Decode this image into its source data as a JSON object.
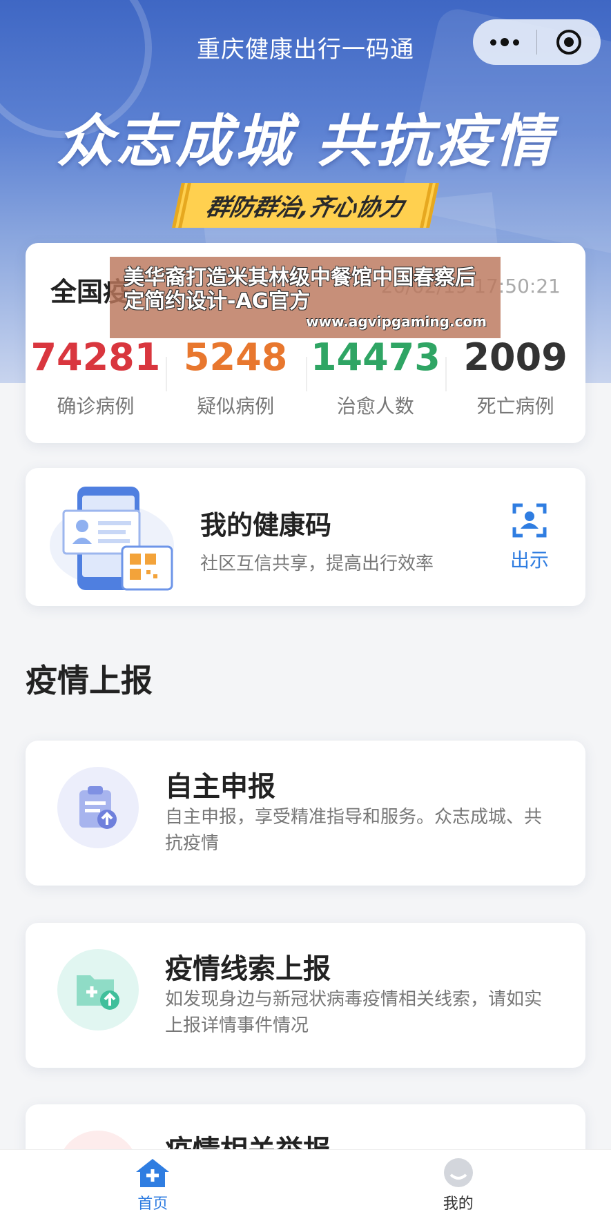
{
  "header": {
    "app_title": "重庆健康出行一码通",
    "slogan": "众志成城 共抗疫情",
    "sub_slogan": "群防群治,齐心协力",
    "capsule_icons": [
      "more-dots-icon",
      "target-close-icon"
    ]
  },
  "stats": {
    "heading": "全国疫",
    "timestamp": "20/02/19 17:50:21",
    "items": [
      {
        "value": "74281",
        "label": "确诊病例",
        "color": "#d9363e"
      },
      {
        "value": "5248",
        "label": "疑似病例",
        "color": "#e8772e"
      },
      {
        "value": "14473",
        "label": "治愈人数",
        "color": "#2fa564"
      },
      {
        "value": "2009",
        "label": "死亡病例",
        "color": "#333333"
      }
    ]
  },
  "watermark": {
    "title": "美华裔打造米其林级中餐馆中国春察后定简约设计-AG官方",
    "url": "www.agvipgaming.com"
  },
  "health_code": {
    "title": "我的健康码",
    "subtitle": "社区互信共享，提高出行效率",
    "show_label": "出示"
  },
  "report_section": {
    "title": "疫情上报",
    "cards": [
      {
        "title": "自主申报",
        "desc": "自主申报，享受精准指导和服务。众志成城、共抗疫情",
        "icon": "clipboard-upload-icon"
      },
      {
        "title": "疫情线索上报",
        "desc": "如发现身边与新冠状病毒疫情相关线索，请如实上报详情事件情况",
        "icon": "folder-plus-upload-icon"
      },
      {
        "title": "疫情相关举报",
        "desc": "",
        "icon": "report-icon"
      }
    ]
  },
  "tabbar": {
    "home_label": "首页",
    "mine_label": "我的",
    "accent": "#2f7de1"
  }
}
